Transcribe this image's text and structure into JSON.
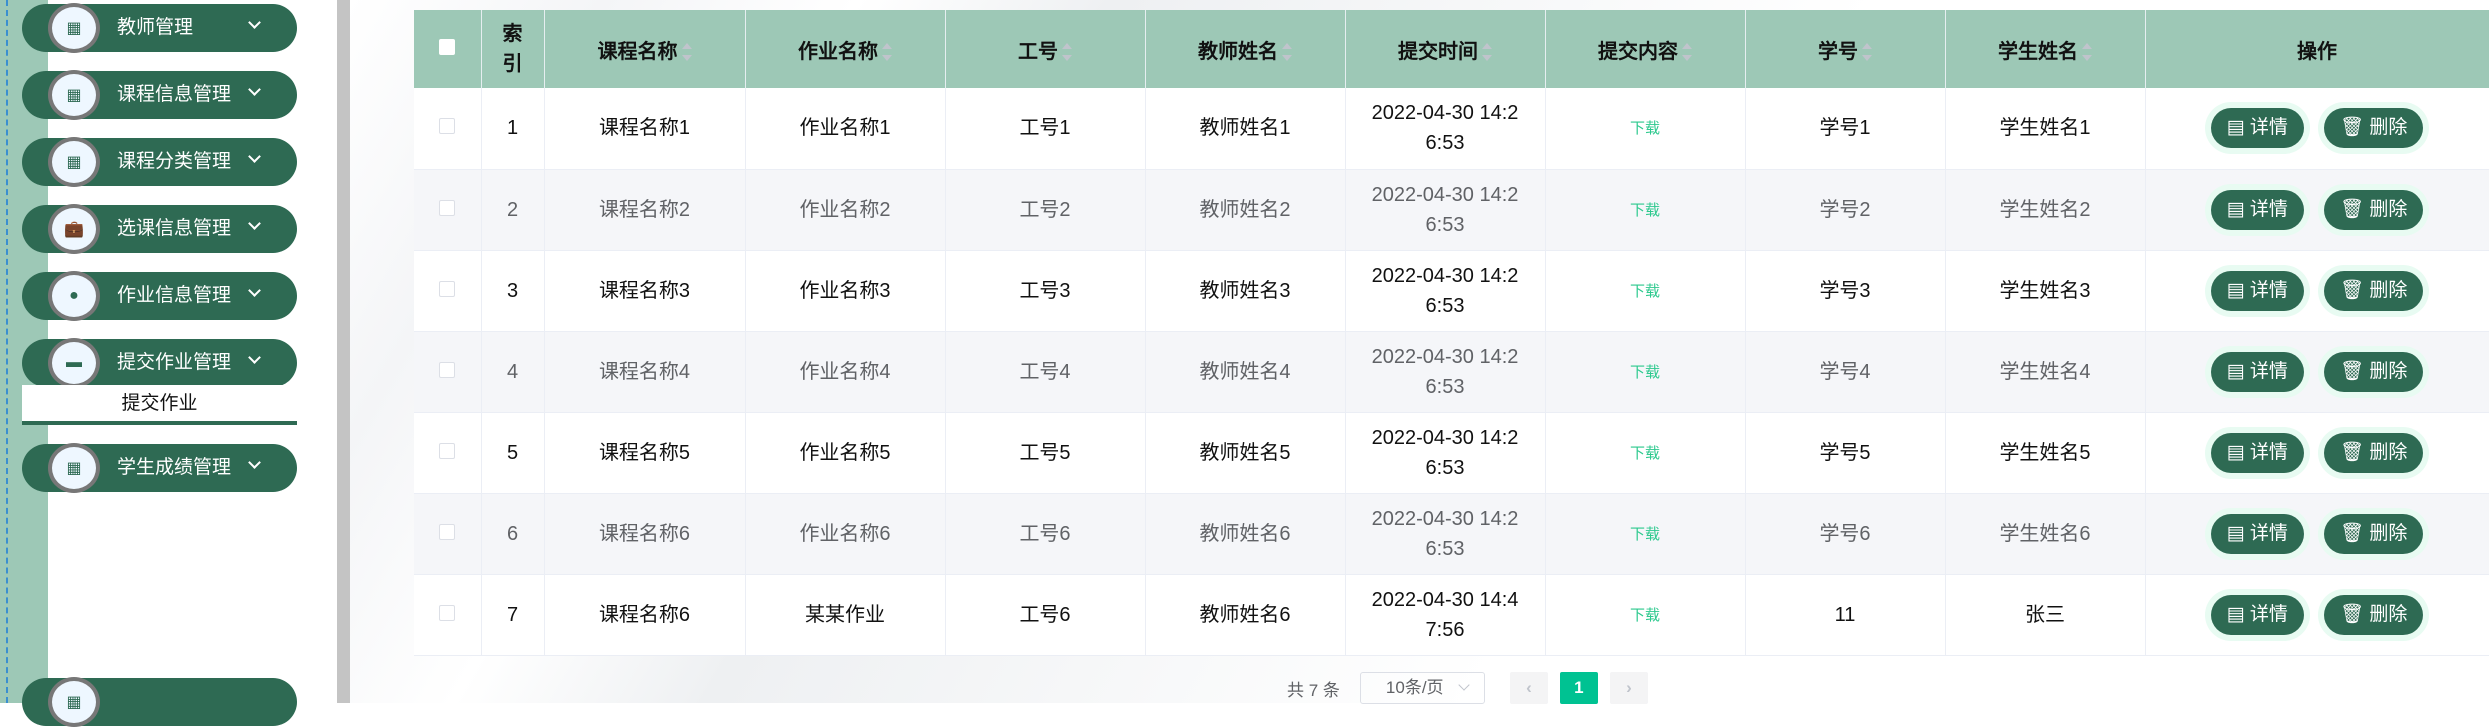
{
  "sidebar": {
    "items": [
      {
        "label": "教师管理",
        "icon": "grid-icon"
      },
      {
        "label": "课程信息管理",
        "icon": "grid-icon"
      },
      {
        "label": "课程分类管理",
        "icon": "grid-icon"
      },
      {
        "label": "选课信息管理",
        "icon": "briefcase-icon"
      },
      {
        "label": "作业信息管理",
        "icon": "location-icon"
      },
      {
        "label": "提交作业管理",
        "icon": "message-icon"
      },
      {
        "label": "学生成绩管理",
        "icon": "grid-icon"
      }
    ],
    "submenu": {
      "label": "提交作业"
    }
  },
  "table": {
    "headers": [
      "索引",
      "课程名称",
      "作业名称",
      "工号",
      "教师姓名",
      "提交时间",
      "提交内容",
      "学号",
      "学生姓名",
      "操作"
    ],
    "rows": [
      {
        "idx": "1",
        "course": "课程名称1",
        "work": "作业名称1",
        "tno": "工号1",
        "tname": "教师姓名1",
        "time": "2022-04-30 14:26:53",
        "content": "下载",
        "sno": "学号1",
        "sname": "学生姓名1"
      },
      {
        "idx": "2",
        "course": "课程名称2",
        "work": "作业名称2",
        "tno": "工号2",
        "tname": "教师姓名2",
        "time": "2022-04-30 14:26:53",
        "content": "下载",
        "sno": "学号2",
        "sname": "学生姓名2"
      },
      {
        "idx": "3",
        "course": "课程名称3",
        "work": "作业名称3",
        "tno": "工号3",
        "tname": "教师姓名3",
        "time": "2022-04-30 14:26:53",
        "content": "下载",
        "sno": "学号3",
        "sname": "学生姓名3"
      },
      {
        "idx": "4",
        "course": "课程名称4",
        "work": "作业名称4",
        "tno": "工号4",
        "tname": "教师姓名4",
        "time": "2022-04-30 14:26:53",
        "content": "下载",
        "sno": "学号4",
        "sname": "学生姓名4"
      },
      {
        "idx": "5",
        "course": "课程名称5",
        "work": "作业名称5",
        "tno": "工号5",
        "tname": "教师姓名5",
        "time": "2022-04-30 14:26:53",
        "content": "下载",
        "sno": "学号5",
        "sname": "学生姓名5"
      },
      {
        "idx": "6",
        "course": "课程名称6",
        "work": "作业名称6",
        "tno": "工号6",
        "tname": "教师姓名6",
        "time": "2022-04-30 14:26:53",
        "content": "下载",
        "sno": "学号6",
        "sname": "学生姓名6"
      },
      {
        "idx": "7",
        "course": "课程名称6",
        "work": "某某作业",
        "tno": "工号6",
        "tname": "教师姓名6",
        "time": "2022-04-30 14:47:56",
        "content": "下载",
        "sno": "11",
        "sname": "张三"
      }
    ],
    "detail_label": "详情",
    "delete_label": "删除"
  },
  "pagination": {
    "total": "共 7 条",
    "page_size": "10条/页",
    "current_page": "1",
    "prev": "‹",
    "next": "›"
  },
  "colors": {
    "primary": "#2e6a53",
    "header": "#9dc8b6",
    "active_page": "#00c292",
    "link": "#2dc98e"
  }
}
